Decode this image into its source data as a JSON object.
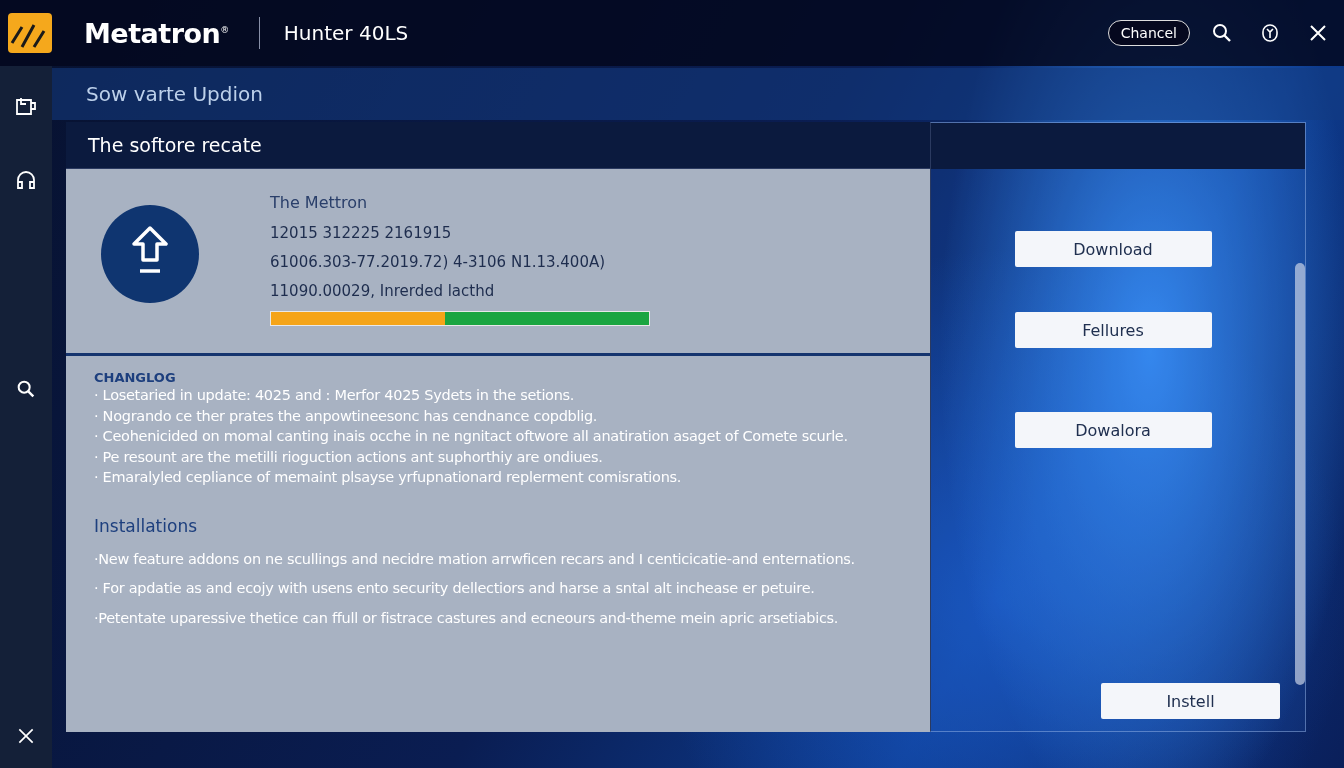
{
  "header": {
    "brand": "Metatron",
    "trademark": "®",
    "product": "Hunter 40LS",
    "cancel_button": "Chancel"
  },
  "page_title": "Sow varte Updion",
  "panel": {
    "title": "The softore recate",
    "info": {
      "name": "The Mettron",
      "lines": [
        "12015 312225 2161915",
        "61006.303-77.2019.72) 4-3106 N1.13.400A)",
        "11090.00029, Inrerded lacthd"
      ],
      "level": 0.46
    },
    "changelog": {
      "heading": "CHANGLOG",
      "items": [
        "· Losetaried in update: 4025 and : Merfor 4025 Sydets in the setions.",
        "· Nogrando ce ther prates the anpowtineesonc has cendnance copdblig.",
        "· Ceohenicided on momal canting inais ocche in ne ngnitact oftwore all anatiration asaget of Comete scurle.",
        "· Pe resount are the metilli rioguction actions ant suphorthiy are ondiues.",
        "· Emaralyled cepliance of memaint plsayse yrfupnationard replerment comisrations."
      ]
    },
    "installations": {
      "heading": "Installations",
      "items": [
        "·New feature addons on ne scullings and necidre mation arrwficen recars and I centicicatie-and enternations.",
        "· For apdatie as and ecojy with usens ento security dellectiors and harse a sntal alt inchease er petuire.",
        "·Petentate uparessive thetice can ffull or fistrace castures and ecneours and-theme mein apric arsetiabics."
      ]
    },
    "actions": [
      "Download",
      "Fellures",
      "Dowalora"
    ],
    "install_button": "Instell"
  }
}
